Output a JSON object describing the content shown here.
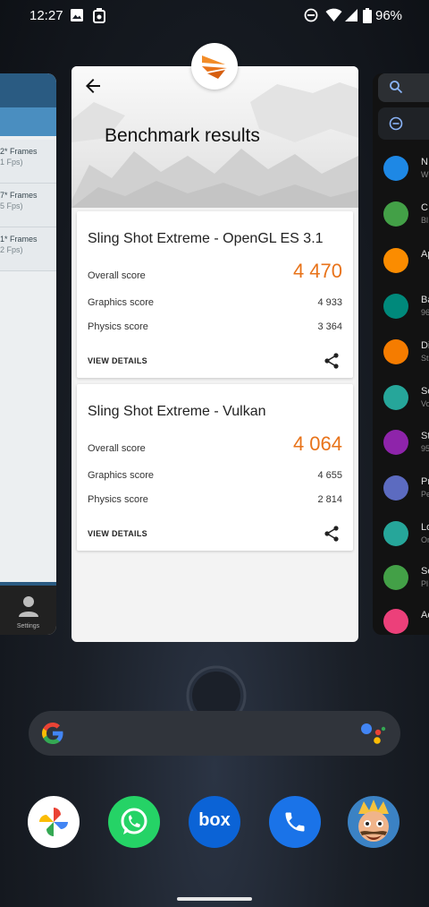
{
  "status_bar": {
    "time": "12:27",
    "battery": "96%",
    "icons": [
      "image-icon",
      "usb-icon",
      "dnd-icon",
      "wifi-icon",
      "signal-icon",
      "battery-icon"
    ]
  },
  "left_card": {
    "rows": [
      {
        "frames": "2* Frames",
        "fps": "1 Fps)"
      },
      {
        "frames": "7* Frames",
        "fps": "5 Fps)"
      },
      {
        "frames": "1* Frames",
        "fps": "2 Fps)"
      }
    ],
    "bottom_label": "Settings"
  },
  "right_card": {
    "items": [
      {
        "title": "N",
        "sub": "W",
        "color": "#1e88e5"
      },
      {
        "title": "C",
        "sub": "Bl",
        "color": "#43a047"
      },
      {
        "title": "Ap",
        "sub": "",
        "color": "#fb8c00"
      },
      {
        "title": "Ba",
        "sub": "96",
        "color": "#00897b"
      },
      {
        "title": "Di",
        "sub": "St",
        "color": "#f57c00"
      },
      {
        "title": "So",
        "sub": "Vo",
        "color": "#26a69a"
      },
      {
        "title": "St",
        "sub": "95",
        "color": "#8e24aa"
      },
      {
        "title": "Pr",
        "sub": "Pe",
        "color": "#5c6bc0"
      },
      {
        "title": "Lo",
        "sub": "On",
        "color": "#26a69a"
      },
      {
        "title": "Se",
        "sub": "Pl",
        "color": "#43a047"
      },
      {
        "title": "Ac",
        "sub": "",
        "color": "#ec407a"
      }
    ]
  },
  "app": {
    "title": "Benchmark results",
    "accent": "#e8731a",
    "results": [
      {
        "name": "Sling Shot Extreme - OpenGL ES 3.1",
        "overall_label": "Overall score",
        "overall_value": "4 470",
        "graphics_label": "Graphics score",
        "graphics_value": "4 933",
        "physics_label": "Physics score",
        "physics_value": "3 364",
        "details_label": "VIEW DETAILS"
      },
      {
        "name": "Sling Shot Extreme - Vulkan",
        "overall_label": "Overall score",
        "overall_value": "4 064",
        "graphics_label": "Graphics score",
        "graphics_value": "4 655",
        "physics_label": "Physics score",
        "physics_value": "2 814",
        "details_label": "VIEW DETAILS"
      }
    ]
  },
  "dock": {
    "apps": [
      "photos-icon",
      "whatsapp-icon",
      "box-icon",
      "phone-icon",
      "clash-royale-icon"
    ],
    "box_label": "box"
  }
}
